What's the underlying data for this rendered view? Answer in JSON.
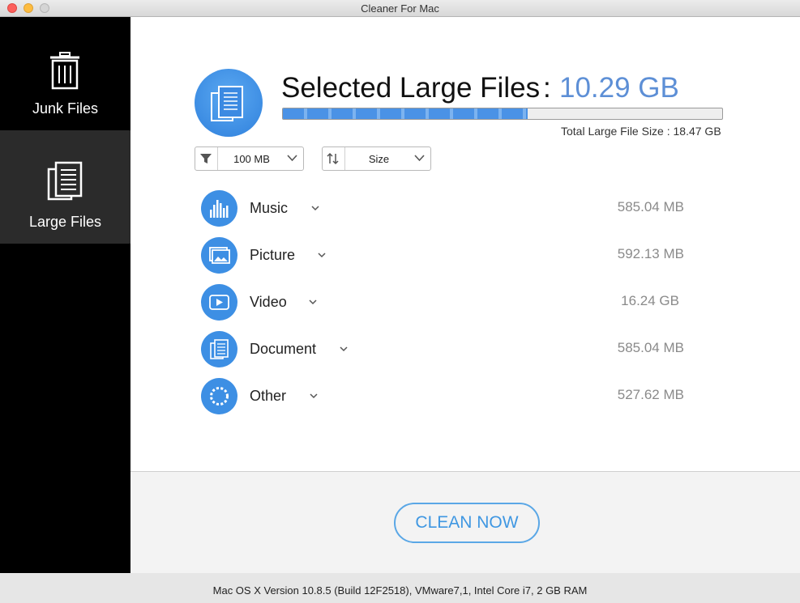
{
  "window": {
    "title": "Cleaner For Mac"
  },
  "sidebar": {
    "items": [
      {
        "label": "Junk Files",
        "icon": "trash-icon",
        "selected": false
      },
      {
        "label": "Large Files",
        "icon": "document-icon",
        "selected": true
      }
    ]
  },
  "header": {
    "title": "Selected Large Files",
    "separator": ":",
    "selected_size": "10.29 GB",
    "total_label": "Total Large File Size : 18.47 GB",
    "progress_fraction": 0.557
  },
  "filters": {
    "size_filter": {
      "value": "100 MB",
      "icon": "filter-icon"
    },
    "sort": {
      "value": "Size",
      "icon": "sort-icon"
    }
  },
  "categories": [
    {
      "label": "Music",
      "size": "585.04 MB",
      "icon": "music-icon"
    },
    {
      "label": "Picture",
      "size": "592.13 MB",
      "icon": "picture-icon"
    },
    {
      "label": "Video",
      "size": "16.24 GB",
      "icon": "video-icon"
    },
    {
      "label": "Document",
      "size": "585.04 MB",
      "icon": "document-icon"
    },
    {
      "label": "Other",
      "size": "527.62 MB",
      "icon": "other-icon"
    }
  ],
  "actions": {
    "clean_label": "CLEAN NOW"
  },
  "status": {
    "text": "Mac OS X Version 10.8.5 (Build 12F2518), VMware7,1, Intel Core i7, 2 GB RAM"
  },
  "colors": {
    "accent": "#3d8fe4",
    "value_blue": "#5d8fd6",
    "sidebar_bg": "#000000",
    "sidebar_selected": "#2b2b2b"
  }
}
